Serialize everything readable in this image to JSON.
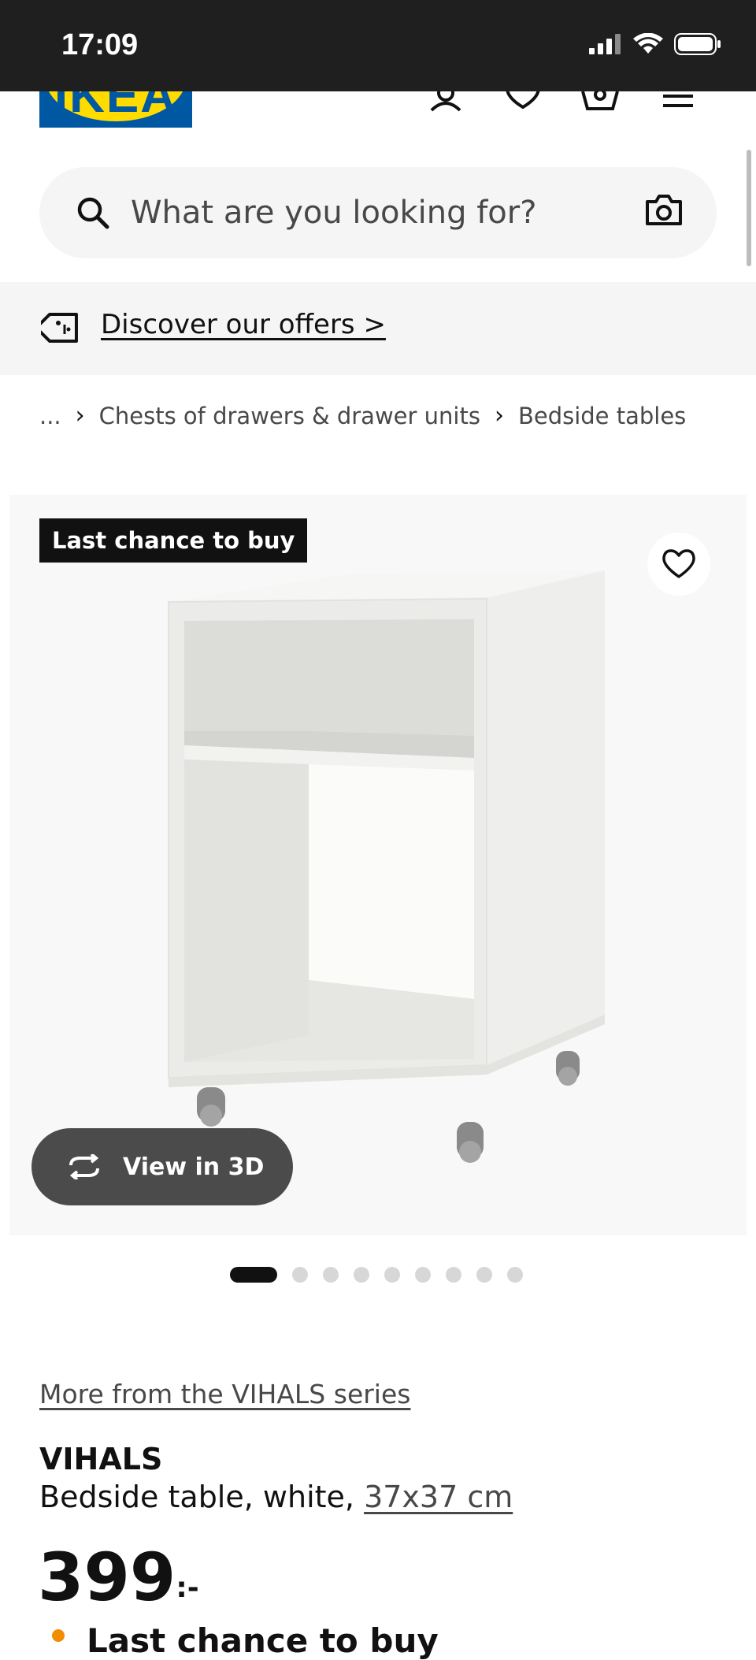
{
  "status_bar": {
    "time": "17:09"
  },
  "header": {
    "logo_text": "IKEA",
    "brand_colors": {
      "blue": "#0058a3",
      "yellow": "#ffdb00"
    }
  },
  "search": {
    "placeholder": "What are you looking for?"
  },
  "offers": {
    "label": "Discover our offers >"
  },
  "breadcrumb": {
    "items": [
      "...",
      "Chests of drawers & drawer units",
      "Bedside tables"
    ]
  },
  "product": {
    "badge": "Last chance to buy",
    "view_3d_label": "View in 3D",
    "image_count": 9,
    "active_image_index": 0,
    "series_link": "More from the VIHALS series",
    "name": "VIHALS",
    "description_prefix": "Bedside table, white, ",
    "size": "37x37 cm",
    "price_integer": "399",
    "price_suffix": ":-",
    "availability_text": "Last chance to buy"
  }
}
